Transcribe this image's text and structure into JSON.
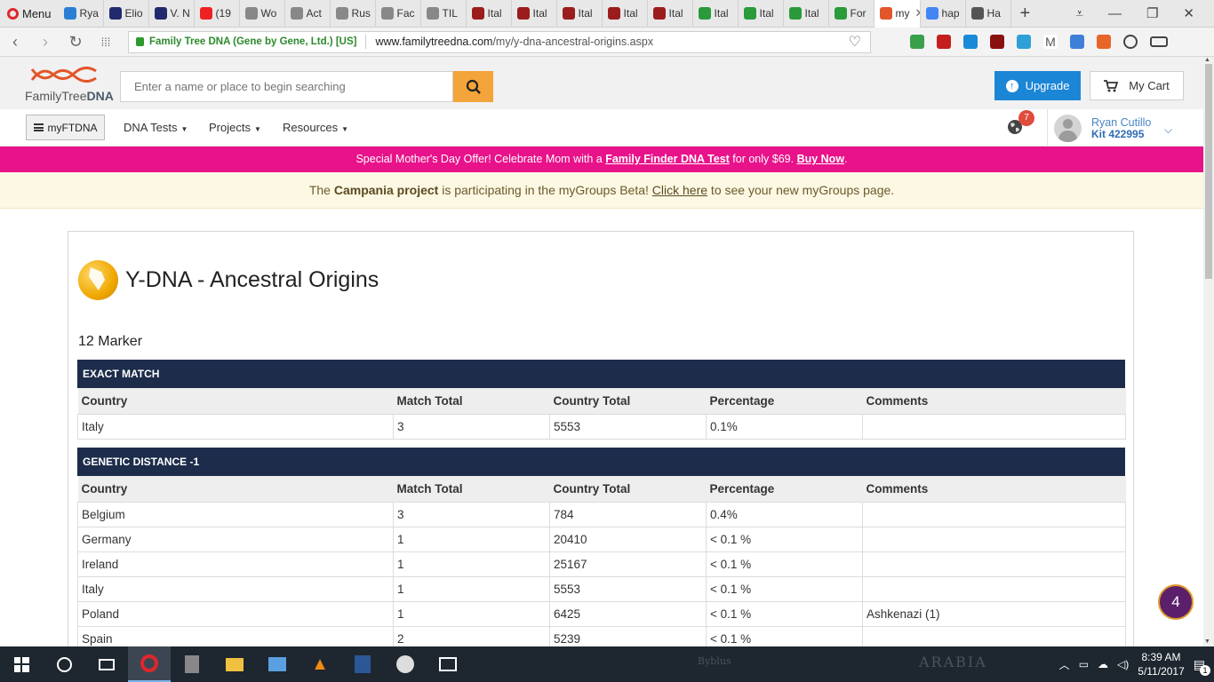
{
  "browser": {
    "menu_label": "Menu",
    "tabs": [
      {
        "label": "Rya",
        "color": "#2a7fd4"
      },
      {
        "label": "Elio",
        "color": "#222a6e"
      },
      {
        "label": "V. N",
        "color": "#222a6e"
      },
      {
        "label": "(19",
        "color": "#e22"
      },
      {
        "label": "Wo",
        "color": "#888"
      },
      {
        "label": "Act",
        "color": "#888"
      },
      {
        "label": "Rus",
        "color": "#888"
      },
      {
        "label": "Fac",
        "color": "#888"
      },
      {
        "label": "TIL",
        "color": "#888"
      },
      {
        "label": "Ital",
        "color": "#9b1c1c"
      },
      {
        "label": "Ital",
        "color": "#9b1c1c"
      },
      {
        "label": "Ital",
        "color": "#9b1c1c"
      },
      {
        "label": "Ital",
        "color": "#9b1c1c"
      },
      {
        "label": "Ital",
        "color": "#9b1c1c"
      },
      {
        "label": "Ital",
        "color": "#2a9a3a"
      },
      {
        "label": "Ital",
        "color": "#2a9a3a"
      },
      {
        "label": "Ital",
        "color": "#2a9a3a"
      },
      {
        "label": "For",
        "color": "#2a9a3a"
      },
      {
        "label": "my",
        "color": "#e2562a",
        "active": true
      },
      {
        "label": "hap",
        "color": "#4285f4"
      },
      {
        "label": "Ha",
        "color": "#555"
      }
    ],
    "site_identity": "Family Tree DNA (Gene by Gene, Ltd.) [US]",
    "url_host": "www.familytreedna.com",
    "url_path": "/my/y-dna-ancestral-origins.aspx"
  },
  "header": {
    "logo_text_plain": "FamilyTree",
    "logo_text_bold": "DNA",
    "search_placeholder": "Enter a name or place to begin searching",
    "upgrade_label": "Upgrade",
    "cart_label": "My Cart"
  },
  "nav": {
    "myftdna_label": "myFTDNA",
    "menus": [
      "DNA Tests",
      "Projects",
      "Resources"
    ],
    "notification_count": "7",
    "user_name": "Ryan Cutillo",
    "user_kit": "Kit 422995"
  },
  "promo": {
    "prefix": "Special Mother's Day Offer! Celebrate Mom with a ",
    "link1": "Family Finder DNA Test",
    "middle": " for only $69. ",
    "link2": "Buy Now",
    "suffix": "."
  },
  "groups_banner": {
    "the": "The ",
    "project": "Campania project",
    "middle": " is participating in the myGroups Beta! ",
    "link": "Click here",
    "suffix": " to see your new myGroups page."
  },
  "page": {
    "title": "Y-DNA - Ancestral Origins",
    "marker": "12 Marker"
  },
  "columns": [
    "Country",
    "Match Total",
    "Country Total",
    "Percentage",
    "Comments"
  ],
  "sections": [
    {
      "title": "EXACT MATCH",
      "rows": [
        [
          "Italy",
          "3",
          "5553",
          "0.1%",
          ""
        ]
      ]
    },
    {
      "title": "GENETIC DISTANCE -1",
      "rows": [
        [
          "Belgium",
          "3",
          "784",
          "0.4%",
          ""
        ],
        [
          "Germany",
          "1",
          "20410",
          "< 0.1 %",
          ""
        ],
        [
          "Ireland",
          "1",
          "25167",
          "< 0.1 %",
          ""
        ],
        [
          "Italy",
          "1",
          "5553",
          "< 0.1 %",
          ""
        ],
        [
          "Poland",
          "1",
          "6425",
          "< 0.1 %",
          "Ashkenazi (1)"
        ],
        [
          "Spain",
          "2",
          "5239",
          "< 0.1 %",
          ""
        ]
      ]
    }
  ],
  "chat_badge": "4",
  "taskbar": {
    "time": "8:39 AM",
    "date": "5/11/2017",
    "notif_count": "1",
    "wallpaper_text_1": "ARABIA",
    "wallpaper_text_2": "Byblus"
  },
  "colors": {
    "accent_pink": "#e8128a",
    "header_navy": "#1c2c4a",
    "search_orange": "#f3a43a",
    "upgrade_blue": "#1c86d6"
  }
}
